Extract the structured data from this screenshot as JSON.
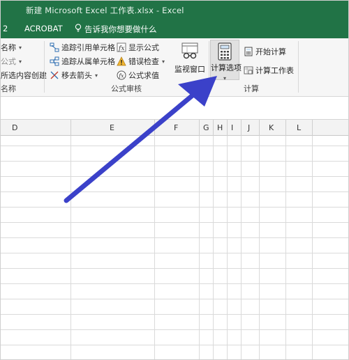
{
  "window": {
    "title": "新建 Microsoft Excel 工作表.xlsx  -  Excel"
  },
  "menu": {
    "tab_partial": "2",
    "acrobat": "ACROBAT",
    "tell_me": "告诉我你想要做什么",
    "accent_color": "#217346"
  },
  "ribbon": {
    "partial_left": {
      "item1": "名称",
      "item2": "公式",
      "item3": "所选内容创建",
      "group_label": "名称"
    },
    "formula_auditing": {
      "trace_precedents": "追踪引用单元格",
      "trace_dependents": "追踪从属单元格",
      "remove_arrows": "移去箭头",
      "show_formulas": "显示公式",
      "error_checking": "错误检查",
      "evaluate_formula": "公式求值",
      "watch_window": "监视窗口",
      "group_label": "公式审核"
    },
    "calculation": {
      "calc_options": "计算选项",
      "calc_now": "开始计算",
      "calc_sheet": "计算工作表",
      "group_label": "计算"
    }
  },
  "sheet": {
    "columns": [
      "D",
      "E",
      "F",
      "G",
      "H",
      "I",
      "J",
      "K",
      "L"
    ]
  },
  "annotation": {
    "arrow_color": "#3b41c9"
  }
}
